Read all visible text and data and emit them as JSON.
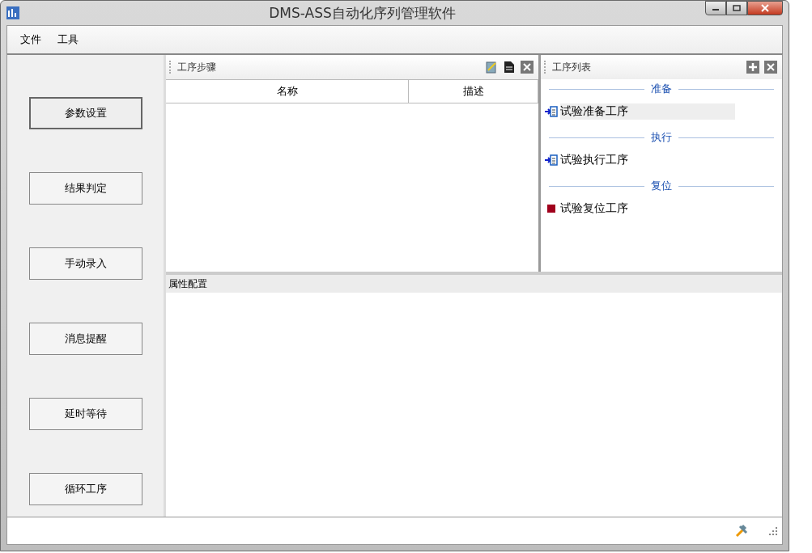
{
  "window": {
    "title": "DMS-ASS自动化序列管理软件"
  },
  "menu": [
    "文件",
    "工具"
  ],
  "tool_buttons": [
    {
      "label": "参数设置",
      "selected": true
    },
    {
      "label": "结果判定",
      "selected": false
    },
    {
      "label": "手动录入",
      "selected": false
    },
    {
      "label": "消息提醒",
      "selected": false
    },
    {
      "label": "延时等待",
      "selected": false
    },
    {
      "label": "循环工序",
      "selected": false
    }
  ],
  "steps_panel": {
    "title": "工序步骤",
    "columns": [
      "名称",
      "描述"
    ]
  },
  "sequence_panel": {
    "title": "工序列表",
    "groups": [
      {
        "name": "准备",
        "items": [
          {
            "label": "试验准备工序",
            "kind": "document",
            "selected": true
          }
        ]
      },
      {
        "name": "执行",
        "items": [
          {
            "label": "试验执行工序",
            "kind": "document",
            "selected": false
          }
        ]
      },
      {
        "name": "复位",
        "items": [
          {
            "label": "试验复位工序",
            "kind": "stop",
            "selected": false
          }
        ]
      }
    ]
  },
  "properties_panel": {
    "title": "属性配置"
  }
}
